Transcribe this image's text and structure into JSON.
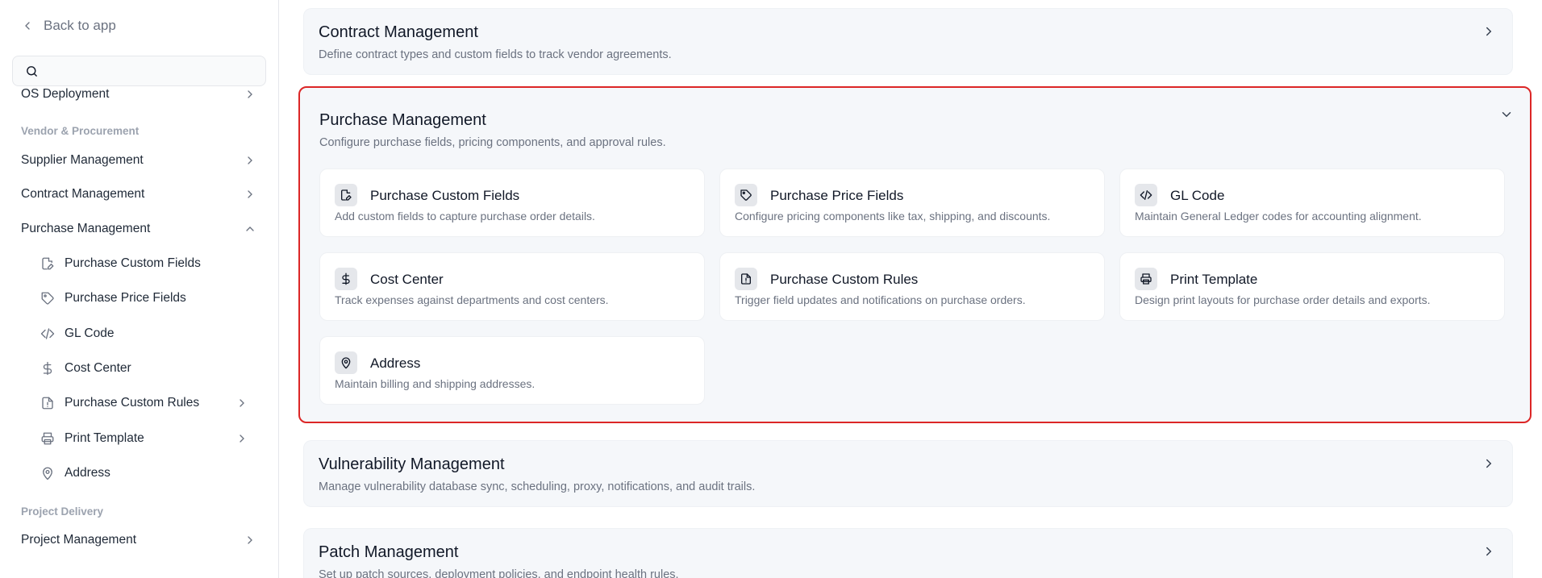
{
  "sidebar": {
    "back_label": "Back to app",
    "search_placeholder": "",
    "items_top": [
      {
        "label": "OS Deployment"
      }
    ],
    "section_vendor": "Vendor & Procurement",
    "vendor_items": [
      {
        "label": "Supplier Management"
      },
      {
        "label": "Contract Management"
      },
      {
        "label": "Purchase Management"
      }
    ],
    "purchase_sub": [
      {
        "label": "Purchase Custom Fields",
        "icon": "file-edit-icon"
      },
      {
        "label": "Purchase Price Fields",
        "icon": "tag-icon"
      },
      {
        "label": "GL Code",
        "icon": "code-icon"
      },
      {
        "label": "Cost Center",
        "icon": "dollar-icon"
      },
      {
        "label": "Purchase Custom Rules",
        "icon": "file-alert-icon"
      },
      {
        "label": "Print Template",
        "icon": "printer-icon"
      },
      {
        "label": "Address",
        "icon": "map-pin-icon"
      }
    ],
    "section_project": "Project Delivery",
    "project_items": [
      {
        "label": "Project Management"
      }
    ]
  },
  "main": {
    "contract": {
      "title": "Contract Management",
      "desc": "Define contract types and custom fields to track vendor agreements."
    },
    "purchase": {
      "title": "Purchase Management",
      "desc": "Configure purchase fields, pricing components, and approval rules.",
      "cards": [
        {
          "title": "Purchase Custom Fields",
          "desc": "Add custom fields to capture purchase order details.",
          "icon": "file-edit-icon"
        },
        {
          "title": "Purchase Price Fields",
          "desc": "Configure pricing components like tax, shipping, and discounts.",
          "icon": "tag-icon"
        },
        {
          "title": "GL Code",
          "desc": "Maintain General Ledger codes for accounting alignment.",
          "icon": "code-icon"
        },
        {
          "title": "Cost Center",
          "desc": "Track expenses against departments and cost centers.",
          "icon": "dollar-icon"
        },
        {
          "title": "Purchase Custom Rules",
          "desc": "Trigger field updates and notifications on purchase orders.",
          "icon": "file-alert-icon"
        },
        {
          "title": "Print Template",
          "desc": "Design print layouts for purchase order details and exports.",
          "icon": "printer-icon"
        },
        {
          "title": "Address",
          "desc": "Maintain billing and shipping addresses.",
          "icon": "map-pin-icon"
        }
      ]
    },
    "vulnerability": {
      "title": "Vulnerability Management",
      "desc": "Manage vulnerability database sync, scheduling, proxy, notifications, and audit trails."
    },
    "patch": {
      "title": "Patch Management",
      "desc": "Set up patch sources, deployment policies, and endpoint health rules."
    }
  },
  "colors": {
    "highlight_border": "#dc2626",
    "panel_bg": "#f5f7fa"
  }
}
